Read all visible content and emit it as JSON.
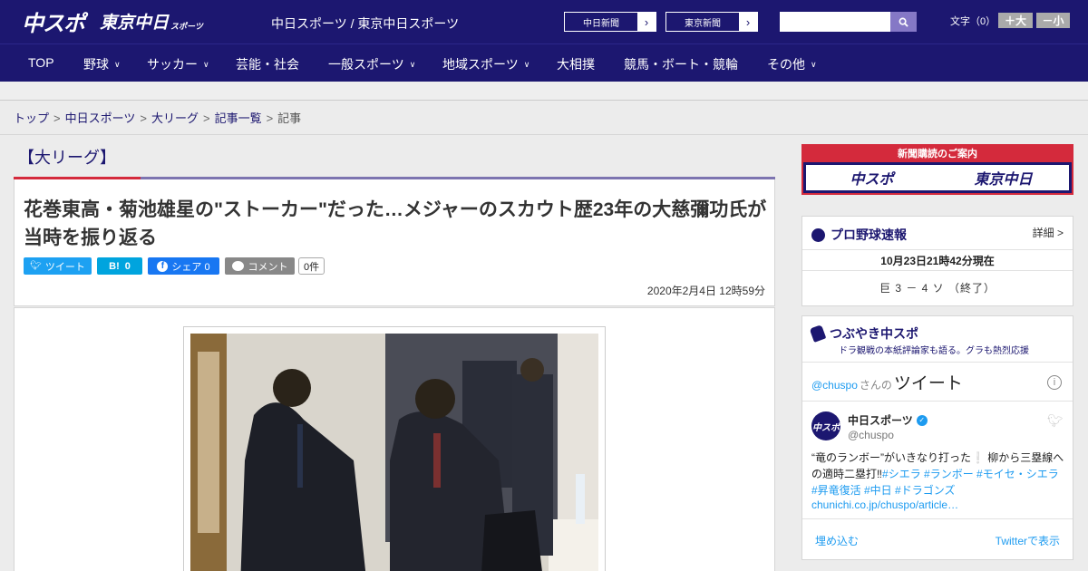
{
  "header": {
    "logo_chuspo": "中スポ",
    "logo_tokyo": "東京中日",
    "logo_tokyo_sub": "スポーツ",
    "site_title": "中日スポーツ / 東京中日スポーツ",
    "link_chunichi": "中日新聞",
    "link_tokyo": "東京新聞",
    "arrow_glyph": "›",
    "search_placeholder": "",
    "font_size_label": "文字（0）",
    "font_up": "＋大",
    "font_down": "－小"
  },
  "nav": {
    "items": [
      {
        "label": "TOP",
        "has_menu": false
      },
      {
        "label": "野球",
        "has_menu": true
      },
      {
        "label": "サッカー",
        "has_menu": true
      },
      {
        "label": "芸能・社会",
        "has_menu": false
      },
      {
        "label": "一般スポーツ",
        "has_menu": true
      },
      {
        "label": "地域スポーツ",
        "has_menu": true
      },
      {
        "label": "大相撲",
        "has_menu": false
      },
      {
        "label": "競馬・ボート・競輪",
        "has_menu": false
      },
      {
        "label": "その他",
        "has_menu": true
      }
    ],
    "chevron": "∨"
  },
  "breadcrumb": {
    "items": [
      "トップ",
      "中日スポーツ",
      "大リーグ",
      "記事一覧"
    ],
    "current": "記事",
    "separator": ">"
  },
  "article": {
    "category": "【大リーグ】",
    "headline": "花巻東高・菊池雄星の\"ストーカー\"だった…メジャーのスカウト歴23年の大慈彌功氏が当時を振り返る",
    "share": {
      "twitter": "ツイート",
      "hatena_icon": "B!",
      "hatena_count": "0",
      "facebook": "シェア 0",
      "comment": "コメント",
      "comment_count": "0件"
    },
    "date": "2020年2月4日 12時59分"
  },
  "sidebar": {
    "ad": {
      "title": "新聞購読のご案内",
      "logo1": "中スポ",
      "logo2": "東京中日"
    },
    "score": {
      "title": "プロ野球速報",
      "detail": "詳細 >",
      "time": "10月23日21時42分現在",
      "line": "巨 3 － 4 ソ （終了）"
    },
    "twitter": {
      "title": "つぶやき中スポ",
      "subtitle": "ドラ観戦の本紙評論家も語る。グラも熱烈応援",
      "handle_caption": "@chuspo",
      "san": "さんの",
      "tweet_word": "ツイート",
      "info": "i",
      "account_name": "中日スポーツ",
      "avatar_text": "中スポ",
      "account_handle": "@chuspo",
      "tweet_text": "“竜のランボー”がいきなり打った❕ 柳から三塁線への適時二塁打‼",
      "tweet_tags": "#シエラ #ランボー #モイセ・シエラ #昇竜復活 #中日 #ドラゴンズ",
      "tweet_link": "chunichi.co.jp/chuspo/article…",
      "embed": "埋め込む",
      "view_on_twitter": "Twitterで表示"
    }
  },
  "colors": {
    "brand_navy": "#1c1770",
    "accent_red": "#d42a3c",
    "twitter_blue": "#1da1f2",
    "facebook_blue": "#1877f2"
  }
}
